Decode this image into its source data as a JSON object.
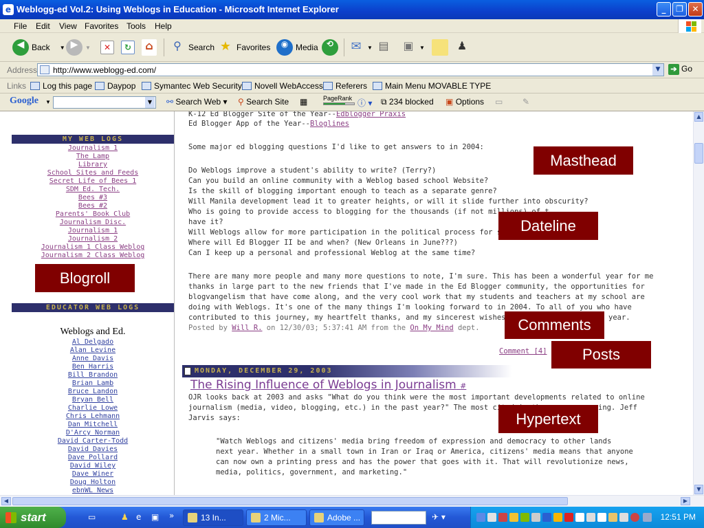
{
  "window": {
    "title": "Weblogg-ed Vol.2: Using Weblogs in Education - Microsoft Internet Explorer"
  },
  "menu": [
    "File",
    "Edit",
    "View",
    "Favorites",
    "Tools",
    "Help"
  ],
  "toolbar": {
    "back": "Back",
    "search": "Search",
    "favorites": "Favorites",
    "media": "Media"
  },
  "address": {
    "label": "Address",
    "url": "http://www.weblogg-ed.com/",
    "go": "Go"
  },
  "links": {
    "label": "Links",
    "items": [
      "Log this page",
      "Daypop",
      "Symantec Web Security",
      "Novell WebAccess",
      "Referers",
      "Main Menu  MOVABLE TYPE"
    ]
  },
  "googlebar": {
    "logo": "Google",
    "search_web": "Search Web",
    "search_site": "Search Site",
    "pagerank": "PageRank",
    "blocked": "234 blocked",
    "options": "Options"
  },
  "sidebar": {
    "my_header": "MY WEB LOGS",
    "my_items": [
      "Journalism 1",
      "The Lamp",
      "Library",
      "School Sites and Feeds",
      "Secret Life of Bees 1",
      "SDM Ed. Tech.",
      "Bees #3",
      "Bees #2",
      "Parents' Book Club",
      "Journalism Disc.",
      "Journalism 1",
      "Journalism 2",
      "Journalism 1 Class Weblog",
      "Journalism 2 Class Weblog"
    ],
    "links_partial": "Links",
    "edu_header": "EDUCATOR WEB LOGS",
    "weblogs_title": "Weblogs and Ed.",
    "edu_items": [
      "Al Delgado",
      "Alan Levine",
      "Anne Davis",
      "Ben Harris",
      "Bill Brandon",
      "Brian Lamb",
      "Bruce Landon",
      "Bryan Bell",
      "Charlie Lowe",
      "Chris Lehmann",
      "Dan Mitchell",
      "D'Arcy Norman",
      "David Carter-Todd",
      "David Davies",
      "Dave Pollard",
      "David Wiley",
      "Dave Winer",
      "Doug Holton",
      "ebnWL News"
    ]
  },
  "main": {
    "award1_text": "K-12 Ed Blogger Site of the Year--",
    "award1_link": "Edblogger Praxis",
    "award2_text": "Ed Blogger App of the Year--",
    "award2_link": "Bloglines",
    "questions_intro": "Some major ed blogging questions I'd like to get answers to in 2004:",
    "questions": [
      "Do Weblogs improve a student's ability to write? (Terry?)",
      "Can you build an online community with a Weblog based school Website?",
      "Is the skill of blogging important enough to teach as a separate genre?",
      "Will Manila development lead it to greater heights, or will it slide further into obscurity?",
      "Who is going to provide access to blogging for the thousands (if not millions) of t...",
      "have it?",
      "Will Weblogs allow for more participation in the political process for students and",
      "Where will Ed Blogger II be and when? (New Orleans in June???)",
      "Can I keep up a personal and professional Weblog at the same time?"
    ],
    "paragraph": [
      "There are many more people and many more questions to note, I'm sure. This has been a wonderful year for me",
      "thanks in large part to the new friends that I've made in the Ed Blogger community, the opportunities for",
      "blogvangelism that have come along, and the very cool work that my students and teachers at my school are",
      "doing with Weblogs. It's one of the many things I'm looking forward to in 2004. To all of you who have",
      "contributed to this journey, my heartfelt thanks, and my sincerest wishes for a pea"
    ],
    "year_end": "year.",
    "posted_prefix": "Posted by ",
    "posted_author": "Will R.",
    "posted_mid": " on 12/30/03; 5:37:41 AM from the ",
    "posted_dept": "On My Mind",
    "posted_suffix": " dept.",
    "comment_link": "Comment [4]",
    "date_header": "MONDAY, DECEMBER 29, 2003",
    "post_title": "The Rising Influence of Weblogs in Journalism",
    "post_hash": "#",
    "post_line1": "OJR looks back at 2003 and asks \"What do you think were the most important developments related to online",
    "post_line2": "journalism (media, video, blogging, etc.) in the past year?\" The most cited is the",
    "post_line2_end": "ing. Jeff",
    "post_line3": "Jarvis says:",
    "quote": [
      "\"Watch Weblogs and citizens' media bring freedom of expression and democracy to other lands",
      "next year. Whether in a small town in Iran or Iraq or America, citizens' media means that anyone",
      "can now own a printing press and has the power that goes with it. That will revolutionize news,",
      "media, politics, government, and marketing.\""
    ]
  },
  "labels": {
    "masthead": "Masthead",
    "dateline": "Dateline",
    "blogroll": "Blogroll",
    "comments": "Comments",
    "posts": "Posts",
    "hypertext": "Hypertext"
  },
  "taskbar": {
    "start": "start",
    "tasks": [
      "13 In...",
      "2 Mic...",
      "Adobe ..."
    ],
    "time": "12:51 PM"
  },
  "colors": {
    "label_bg": "#800000",
    "header_bg": "#2d2f6b",
    "header_text": "#c7b14e",
    "link": "#8a3d83"
  }
}
